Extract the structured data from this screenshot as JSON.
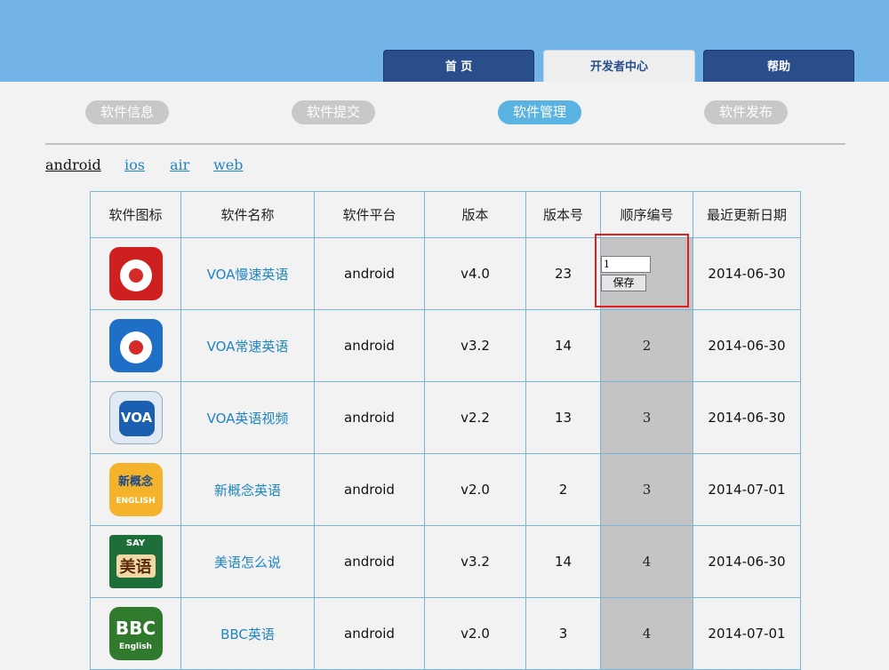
{
  "nav": {
    "tabs": [
      {
        "label": "首 页",
        "active": false
      },
      {
        "label": "开发者中心",
        "active": true
      },
      {
        "label": "帮助",
        "active": false
      }
    ]
  },
  "subnav": {
    "items": [
      {
        "label": "软件信息",
        "active": false
      },
      {
        "label": "软件提交",
        "active": false
      },
      {
        "label": "软件管理",
        "active": true
      },
      {
        "label": "软件发布",
        "active": false
      }
    ]
  },
  "platforms": [
    {
      "label": "android",
      "active": true
    },
    {
      "label": "ios",
      "active": false
    },
    {
      "label": "air",
      "active": false
    },
    {
      "label": "web",
      "active": false
    }
  ],
  "table": {
    "headers": [
      "软件图标",
      "软件名称",
      "软件平台",
      "版本",
      "版本号",
      "顺序编号",
      "最近更新日期"
    ],
    "rows": [
      {
        "icon": "voa-slow-icon",
        "name": "VOA慢速英语",
        "platform": "android",
        "version": "v4.0",
        "build": "23",
        "order": "1",
        "date": "2014-06-30",
        "editing": true
      },
      {
        "icon": "voa-standard-icon",
        "name": "VOA常速英语",
        "platform": "android",
        "version": "v3.2",
        "build": "14",
        "order": "2",
        "date": "2014-06-30",
        "editing": false
      },
      {
        "icon": "voa-video-icon",
        "name": "VOA英语视频",
        "platform": "android",
        "version": "v2.2",
        "build": "13",
        "order": "3",
        "date": "2014-06-30",
        "editing": false
      },
      {
        "icon": "new-concept-icon",
        "name": "新概念英语",
        "platform": "android",
        "version": "v2.0",
        "build": "2",
        "order": "3",
        "date": "2014-07-01",
        "editing": false
      },
      {
        "icon": "american-say-icon",
        "name": "美语怎么说",
        "platform": "android",
        "version": "v3.2",
        "build": "14",
        "order": "4",
        "date": "2014-06-30",
        "editing": false
      },
      {
        "icon": "bbc-english-icon",
        "name": "BBC英语",
        "platform": "android",
        "version": "v2.0",
        "build": "3",
        "order": "4",
        "date": "2014-07-01",
        "editing": false
      }
    ],
    "save_label": "保存"
  },
  "icon_text": {
    "nce_top": "新概念",
    "nce_bottom": "ENGLISH",
    "say_top": "SAY",
    "say_main": "美语",
    "bbc_main": "BBC",
    "bbc_sub": "English"
  },
  "colors": {
    "header_bg": "#72b3e8",
    "tab_dark": "#2a4e8a",
    "pill_active": "#5ab3e0",
    "pill_inactive": "#c8c8c8",
    "link": "#1f85c3",
    "order_bg": "#c4c4c4",
    "highlight": "#e02020"
  }
}
